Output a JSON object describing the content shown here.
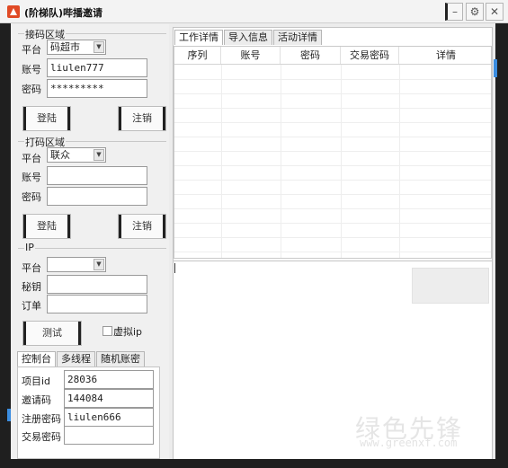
{
  "window": {
    "title": "(阶梯队)哔播邀请"
  },
  "receive_section": {
    "label": "接码区域",
    "platform_label": "平台",
    "platform_value": "码超市",
    "account_label": "账号",
    "account_value": "liulen777",
    "password_label": "密码",
    "password_value": "*********",
    "login_label": "登陆",
    "logout_label": "注销"
  },
  "captcha_section": {
    "label": "打码区域",
    "platform_label": "平台",
    "platform_value": "联众",
    "account_label": "账号",
    "account_value": "",
    "password_label": "密码",
    "password_value": "",
    "login_label": "登陆",
    "logout_label": "注销"
  },
  "ip_section": {
    "label": "IP",
    "platform_label": "平台",
    "platform_value": "",
    "key_label": "秘钥",
    "key_value": "",
    "order_label": "订单",
    "order_value": "",
    "test_label": "测试",
    "virtual_ip_label": "虚拟ip",
    "virtual_ip_checked": false
  },
  "bottom_tabs": [
    "控制台",
    "多线程",
    "随机账密"
  ],
  "console": {
    "project_id_label": "项目id",
    "project_id_value": "28036",
    "invite_code_label": "邀请码",
    "invite_code_value": "144084",
    "register_password_label": "注册密码",
    "register_password_value": "liulen666",
    "trade_password_label": "交易密码",
    "trade_password_value": ""
  },
  "right_tabs": [
    "工作详情",
    "导入信息",
    "活动详情"
  ],
  "table": {
    "columns": [
      "序列",
      "账号",
      "密码",
      "交易密码",
      "详情"
    ],
    "rows": []
  },
  "watermark": {
    "text": "绿色先锋",
    "sub": "www.greenxf.com"
  },
  "colors": {
    "frame": "#1f1f1f",
    "accent": "#3b8de0",
    "app_icon": "#e04a25"
  }
}
